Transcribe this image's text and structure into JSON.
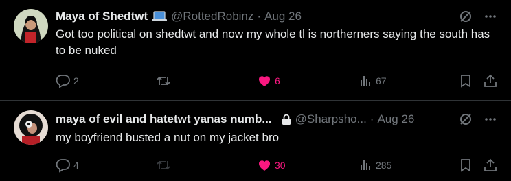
{
  "tweets": [
    {
      "display_name": "Maya of Shedtwt",
      "badge_icon": "laptop-icon",
      "handle": "@RottedRobinz",
      "separator": "·",
      "date": "Aug 26",
      "text": "Got too political on shedtwt and now my whole tl is northerners saying the south has to be nuked",
      "replies": "2",
      "likes": "6",
      "liked": true,
      "views": "67"
    },
    {
      "display_name": "maya of evil and hatetwt yanas numb...",
      "badge_icon": "lock-icon",
      "handle": "@Sharpsho...",
      "separator": "·",
      "date": "Aug 26",
      "text": "my boyfriend busted a nut on my jacket bro",
      "replies": "4",
      "likes": "30",
      "liked": true,
      "views": "285"
    }
  ],
  "colors": {
    "background": "#000000",
    "text": "#e7e9ea",
    "muted": "#71767b",
    "like": "#f91880",
    "divider": "#2f3336"
  }
}
